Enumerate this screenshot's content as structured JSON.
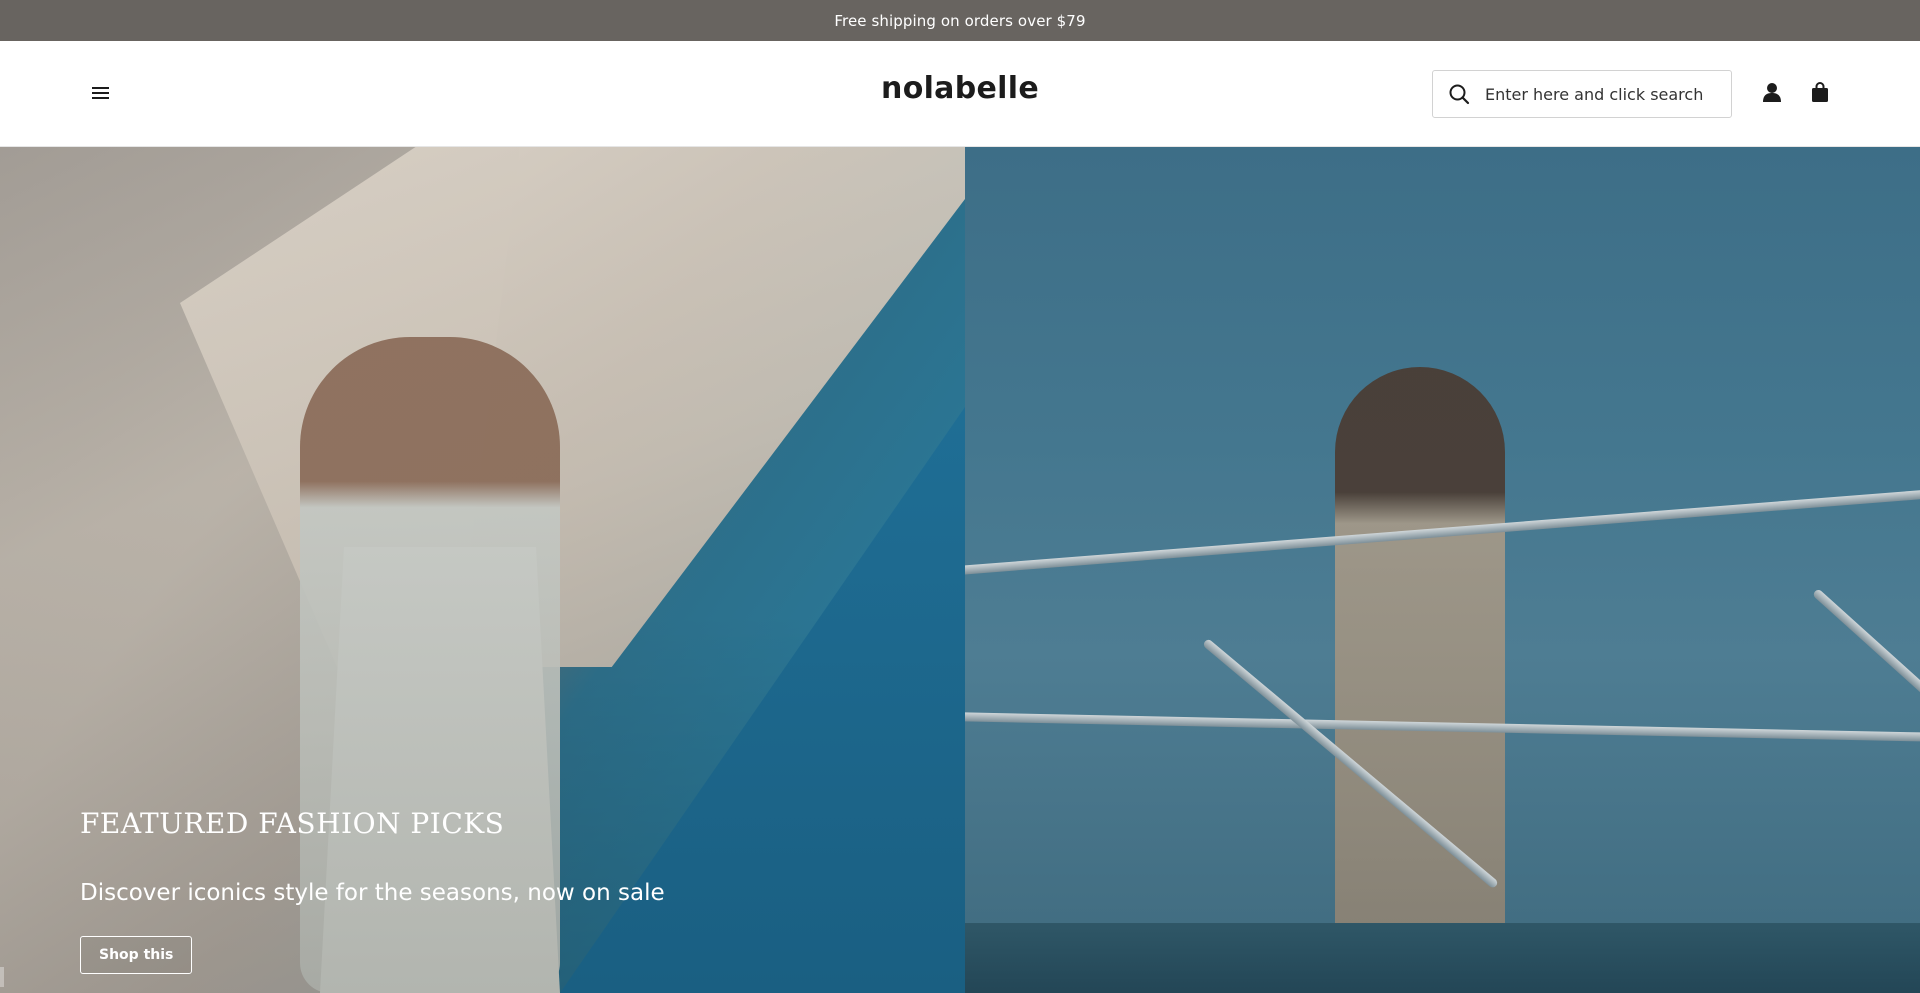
{
  "announcement": {
    "text": "Free shipping on orders over $79"
  },
  "header": {
    "logo": "nolabelle",
    "menu_icon": "hamburger-menu-icon",
    "search": {
      "placeholder": "Enter here and click search",
      "value": "",
      "icon": "search-icon"
    },
    "account_icon": "user-icon",
    "cart_icon": "shopping-bag-icon"
  },
  "hero": {
    "title": "FEATURED FASHION PICKS",
    "subtitle": "Discover iconics style for the seasons, now on sale",
    "button_label": "Shop this"
  },
  "colors": {
    "announcement_bg": "#686460",
    "header_bg": "#ffffff",
    "text_dark": "#1c1c1c"
  }
}
